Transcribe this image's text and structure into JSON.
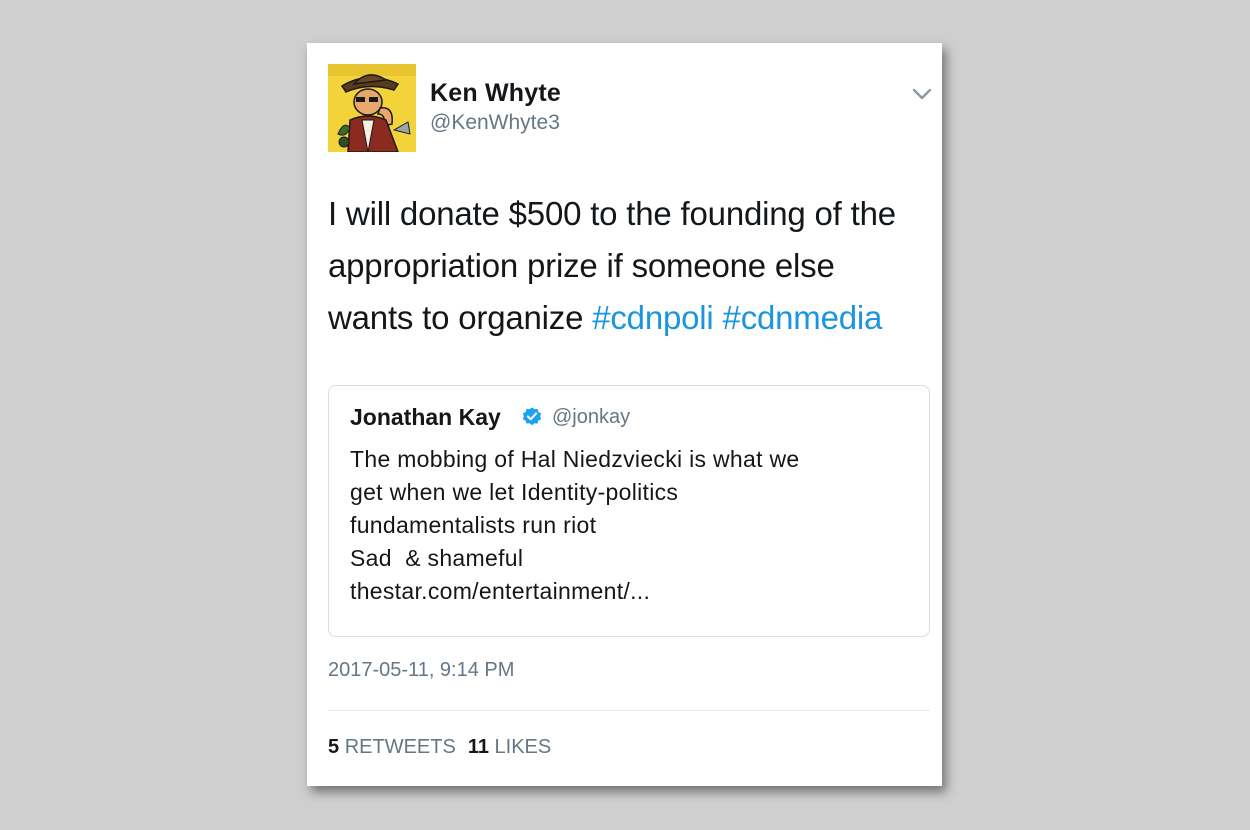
{
  "tweet": {
    "author": {
      "name": "Ken Whyte",
      "handle": "@KenWhyte3",
      "avatar": "comic-illustration-avatar"
    },
    "menu_icon": "chevron-down-icon",
    "text": {
      "line1": "I will donate $500 to the founding of the",
      "line2": "appropriation prize if someone else",
      "line3_prefix": "wants to organize ",
      "hashtags": [
        "#cdnpoli",
        "#cdnmedia"
      ]
    },
    "quoted": {
      "name": "Jonathan Kay",
      "verified_icon": "verified-badge-icon",
      "handle": "@jonkay",
      "lines": [
        "The mobbing of Hal Niedzviecki is what we",
        "get when we let Identity-politics",
        "fundamentalists run riot",
        "Sad  & shameful",
        "thestar.com/entertainment/..."
      ]
    },
    "timestamp": "2017-05-11, 9:14 PM",
    "stats": {
      "retweets_count": "5",
      "retweets_label": "RETWEETS",
      "likes_count": "11",
      "likes_label": "LIKES"
    }
  },
  "colors": {
    "background": "#cfcfcf",
    "card": "#ffffff",
    "hashtag": "#1b95e0",
    "secondary_text": "#657786",
    "verified": "#1da1f2"
  }
}
